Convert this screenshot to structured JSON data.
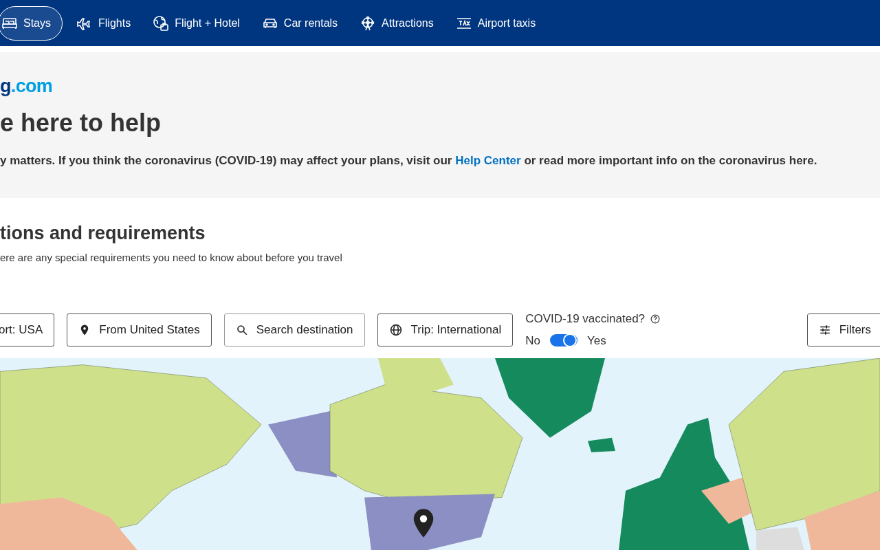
{
  "nav": [
    {
      "kind": "bed",
      "label": "Stays",
      "selected": true
    },
    {
      "kind": "plane",
      "label": "Flights",
      "selected": false
    },
    {
      "kind": "globe-bag",
      "label": "Flight + Hotel",
      "selected": false
    },
    {
      "kind": "car",
      "label": "Car rentals",
      "selected": false
    },
    {
      "kind": "ferris",
      "label": "Attractions",
      "selected": false
    },
    {
      "kind": "taxi",
      "label": "Airport taxis",
      "selected": false
    }
  ],
  "logo": {
    "brand": "g",
    "suffix": ".com"
  },
  "hero": {
    "title": "e here to help",
    "text_before": "y matters. If you think the coronavirus (COVID-19) may affect your plans, visit our",
    "link": "Help Center",
    "text_after": "or read more important info on the coronavirus here."
  },
  "section": {
    "title": "tions and requirements",
    "subtitle": "ere are any special requirements you need to know about before you travel"
  },
  "filters": [
    {
      "kind": "plain",
      "label": "ort: USA"
    },
    {
      "kind": "pin",
      "label": "From United States"
    },
    {
      "kind": "search",
      "label": "Search destination"
    },
    {
      "kind": "globe",
      "label": "Trip: International"
    }
  ],
  "vaccinated": {
    "label": "COVID-19 vaccinated?",
    "off_label": "No",
    "on_label": "Yes",
    "on": true
  },
  "filters_button": "Filters"
}
